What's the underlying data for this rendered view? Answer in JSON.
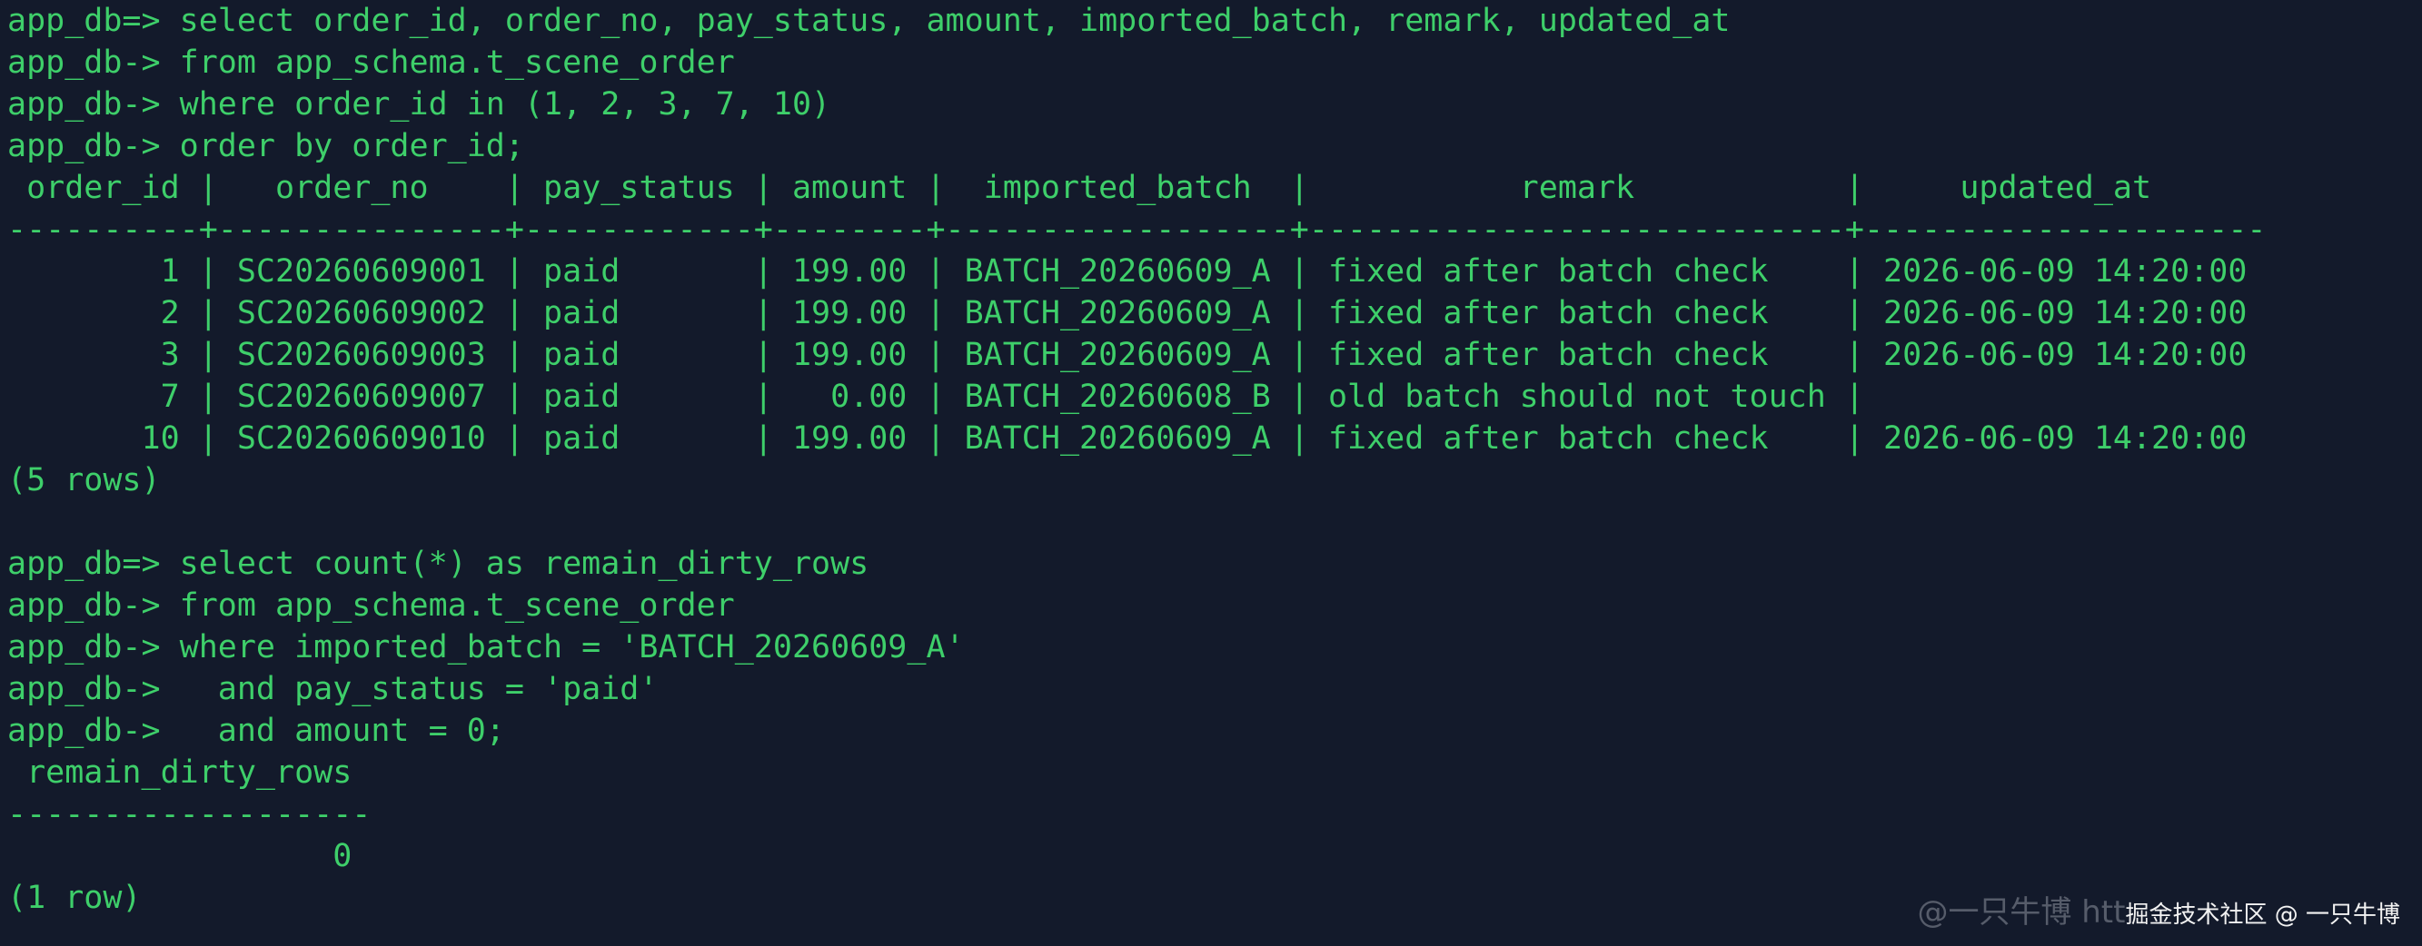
{
  "terminal": {
    "lines": [
      "app_db=> select order_id, order_no, pay_status, amount, imported_batch, remark, updated_at",
      "app_db-> from app_schema.t_scene_order",
      "app_db-> where order_id in (1, 2, 3, 7, 10)",
      "app_db-> order by order_id;",
      " order_id |   order_no    | pay_status | amount |  imported_batch  |           remark           |     updated_at",
      "----------+---------------+------------+--------+------------------+----------------------------+---------------------",
      "        1 | SC20260609001 | paid       | 199.00 | BATCH_20260609_A | fixed after batch check    | 2026-06-09 14:20:00",
      "        2 | SC20260609002 | paid       | 199.00 | BATCH_20260609_A | fixed after batch check    | 2026-06-09 14:20:00",
      "        3 | SC20260609003 | paid       | 199.00 | BATCH_20260609_A | fixed after batch check    | 2026-06-09 14:20:00",
      "        7 | SC20260609007 | paid       |   0.00 | BATCH_20260608_B | old batch should not touch |",
      "       10 | SC20260609010 | paid       | 199.00 | BATCH_20260609_A | fixed after batch check    | 2026-06-09 14:20:00",
      "(5 rows)",
      "",
      "app_db=> select count(*) as remain_dirty_rows",
      "app_db-> from app_schema.t_scene_order",
      "app_db-> where imported_batch = 'BATCH_20260609_A'",
      "app_db->   and pay_status = 'paid'",
      "app_db->   and amount = 0;",
      " remain_dirty_rows",
      "-------------------",
      "                 0",
      "(1 row)"
    ]
  },
  "watermark": {
    "faded": "@一只牛博 htt",
    "main": "掘金技术社区 @ 一只牛博"
  },
  "colors": {
    "background": "#131a2b",
    "text": "#3ecf6a"
  }
}
